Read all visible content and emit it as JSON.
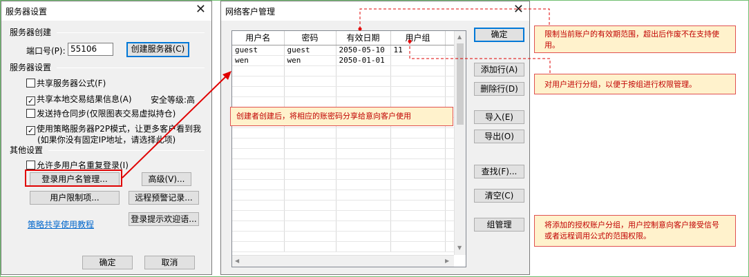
{
  "server_settings": {
    "title": "服务器设置",
    "create_section": "服务器创建",
    "port_label": "端口号(P):",
    "port_value": "55106",
    "create_button": "创建服务器(C)",
    "settings_section": "服务器设置",
    "options": [
      {
        "label": "共享服务器公式(F)",
        "checked": false
      },
      {
        "label": "共享本地交易结果信息(A)",
        "checked": true
      },
      {
        "label": "发送持仓同步(仅限图表交易虚拟持仓)",
        "checked": false
      },
      {
        "label": "使用策略服务器P2P模式，让更多客户看到我",
        "checked": true
      }
    ],
    "security_level": "安全等级:高",
    "p2p_note": "(如果你没有固定IP地址，请选择此项)",
    "other_section": "其他设置",
    "allow_duplicate_login": "允许多用户名重复登录(I)",
    "login_user_mgmt_button": "登录用户名管理...",
    "advanced_button": "高级(V)...",
    "user_restrict_button": "用户限制项...",
    "remote_alert_button": "远程预警记录...",
    "tutorial_link": "策略共享使用教程",
    "login_welcome_button": "登录提示欢迎语...",
    "ok_button": "确定",
    "cancel_button": "取消"
  },
  "client_mgmt": {
    "title": "网络客户管理",
    "columns": [
      "用户名",
      "密码",
      "有效日期",
      "用户组"
    ],
    "rows": [
      [
        "guest",
        "guest",
        "2050-05-10",
        "11"
      ],
      [
        "wen",
        "wen",
        "2050-01-01",
        ""
      ]
    ],
    "buttons": {
      "ok": "确定",
      "add_row": "添加行(A)",
      "delete_row": "删除行(D)",
      "import": "导入(E)",
      "export": "导出(O)",
      "find": "查找(F)...",
      "clear": "清空(C)",
      "group_mgmt": "组管理"
    }
  },
  "annotations": {
    "share_note": "创建者创建后，将相应的账密码分享给意向客户使用",
    "expiry_note": "限制当前账户的有效期范围，超出后作废不在支持使用。",
    "group_note": "对用户进行分组，以便于按组进行权限管理。",
    "group_mgmt_note": "将添加的授权账户分组，用户控制意向客户接受信号或者远程调用公式的范围权限。"
  },
  "colors": {
    "annotation_red": "#e00000",
    "note_fill": "#fff2cc",
    "link_blue": "#0066cc",
    "focus_blue": "#0078d7"
  }
}
